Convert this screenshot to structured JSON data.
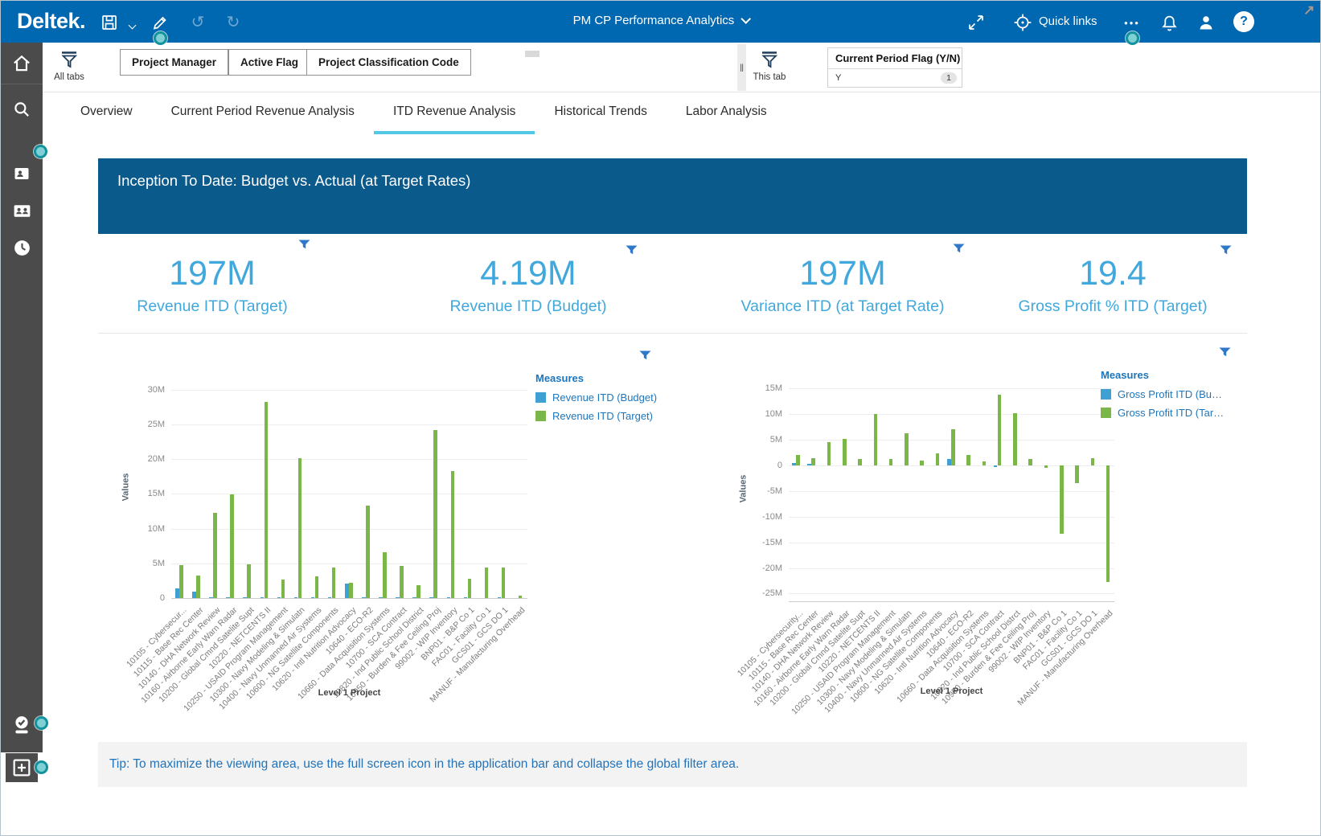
{
  "topbar": {
    "logo": "Deltek.",
    "title": "PM CP Performance Analytics",
    "quick_links_label": "Quick links",
    "icons": {
      "undo": "↺",
      "redo": "↻",
      "ellipsis": "•••",
      "help": "?",
      "cursor": "↗",
      "drag_handle": "‖"
    }
  },
  "sidebar": {
    "icons": [
      "home",
      "search",
      "project-folder",
      "contacts",
      "history-clock",
      "user-check",
      "add"
    ]
  },
  "filters": {
    "all_tabs_label": "All tabs",
    "chips": [
      "Project Manager",
      "Active Flag",
      "Project Classification Code"
    ],
    "this_tab_label": "This tab",
    "tab_filter": {
      "title": "Current Period Flag (Y/N)",
      "value": "Y",
      "count": "1"
    }
  },
  "tabs": {
    "items": [
      "Overview",
      "Current Period Revenue Analysis",
      "ITD Revenue Analysis",
      "Historical Trends",
      "Labor Analysis"
    ],
    "active_index": 2
  },
  "banner": {
    "title": "Inception To Date:  Budget vs. Actual (at Target Rates)"
  },
  "kpis": [
    {
      "value": "197M",
      "label": "Revenue ITD (Target)"
    },
    {
      "value": "4.19M",
      "label": "Revenue ITD (Budget)"
    },
    {
      "value": "197M",
      "label": "Variance ITD (at Target Rate)"
    },
    {
      "value": "19.4",
      "label": "Gross Profit % ITD (Target)"
    }
  ],
  "tip": "Tip:  To maximize the viewing area, use the full screen icon in the application bar and collapse the global filter area.",
  "colors": {
    "topbar_blue": "#0067b1",
    "banner_blue": "#0a5a8c",
    "kpi_blue": "#41a8dd",
    "tab_underline_cyan": "#53c8e4",
    "bar_blue": "#3fa0d4",
    "bar_green": "#7ab648",
    "legend_text_blue": "#1d76bc",
    "teal_dot": "#12929c",
    "sidebar_gray": "#4b4b4b"
  },
  "chart_data": [
    {
      "type": "bar",
      "units": "millions",
      "ylabel": "Values",
      "xlabel": "Level 1 Project",
      "legend_title": "Measures",
      "legend_position": "right",
      "grid": true,
      "ylim": [
        0,
        31.5
      ],
      "yticks": [
        30,
        25,
        20,
        15,
        10,
        5,
        0
      ],
      "categories": [
        "10105 - Cybersecur...",
        "10115 - Base Rec Center",
        "10140 - DHA Network Review",
        "10160 - Airborne Early Warn Radar",
        "10200 - Global Cmnd Satelite Supt",
        "10220 - NETCENTS II",
        "10250 - USAID Program Management",
        "10300 - Navy Modeling & Simulatn",
        "10400 - Navy Unmanned Air Systems",
        "10600 - NG Satellite Components",
        "10620 - Intl Nutrition Advocacy",
        "10640 - ECO-R2",
        "10660 - Data Acquisition Systems",
        "10700 - SCA Contract",
        "10820 - Ind Public School District",
        "10950 - Burden & Fee Ceiling Proj",
        "99002 - WIP Inventory",
        "BNP01 - B&P Co 1",
        "FAC01 - Facility Co 1",
        "GCS01 - GCS DO 1",
        "MANUF - Manufacturing Overhead"
      ],
      "series": [
        {
          "name": "Revenue ITD (Budget)",
          "legend_label": "Revenue ITD (Budget)",
          "color": "#3fa0d4",
          "values": [
            1.4,
            0.9,
            0.1,
            0.1,
            0.1,
            0.1,
            0.1,
            0.1,
            0.1,
            0.1,
            2.1,
            0.1,
            0.1,
            0.1,
            0.1,
            0.1,
            0.1,
            0.1,
            0,
            0.1,
            0
          ]
        },
        {
          "name": "Revenue ITD (Target)",
          "legend_label": "Revenue ITD (Target)",
          "color": "#7ab648",
          "values": [
            4.7,
            3.3,
            12.3,
            14.9,
            4.9,
            28.2,
            2.7,
            20.2,
            3.1,
            4.4,
            2.2,
            13.3,
            6.6,
            4.6,
            1.8,
            24.2,
            18.3,
            2.8,
            4.4,
            4.4,
            0.3
          ]
        }
      ]
    },
    {
      "type": "bar",
      "units": "millions",
      "ylabel": "Values",
      "xlabel": "Level 1 Project",
      "legend_title": "Measures",
      "legend_position": "right",
      "grid": true,
      "ylim": [
        -26.5,
        16.8
      ],
      "yticks": [
        15,
        10,
        5,
        0,
        -5,
        -10,
        -15,
        -20,
        -25
      ],
      "categories": [
        "10105 - Cybersecurity...",
        "10115 - Base Rec Center",
        "10140 - DHA Network Review",
        "10160 - Airborne Early Warn Radar",
        "10200 - Global Cmnd Satelite Supt",
        "10220 - NETCENTS II",
        "10250 - USAID Program Management",
        "10300 - Navy Modeling & Simulatn",
        "10400 - Navy Unmanned Air Systems",
        "10600 - NG Satellite Components",
        "10620 - Intl Nutrition Advocacy",
        "10640 - ECO-R2",
        "10660 - Data Acquisition Systems",
        "10700 - SCA Contract",
        "10820 - Ind Public School Distrct",
        "10950 - Burden & Fee Ceiling Proj",
        "99002 - WIP Inventory",
        "BNP01 - B&P Co 1",
        "FAC01 - Facility Co 1",
        "GCS01 - GCS DO 1",
        "MANUF - Manufacturing Overhead"
      ],
      "series": [
        {
          "name": "Gross Profit ITD (Budget)",
          "legend_label": "Gross Profit ITD (Bu…",
          "color": "#3fa0d4",
          "values": [
            0.5,
            0.4,
            0,
            0,
            0,
            0,
            0,
            0,
            0,
            0,
            1.2,
            0,
            0,
            -0.2,
            0,
            0,
            0,
            0,
            0,
            0,
            0
          ]
        },
        {
          "name": "Gross Profit ITD (Target)",
          "legend_label": "Gross Profit ITD (Tar…",
          "color": "#7ab648",
          "values": [
            2.0,
            1.4,
            4.6,
            5.2,
            1.2,
            10.0,
            1.2,
            6.3,
            0.9,
            2.4,
            7.0,
            2.1,
            0.8,
            13.8,
            10.2,
            1.2,
            -0.5,
            -13.4,
            -3.4,
            1.5,
            -22.8
          ]
        }
      ]
    }
  ]
}
